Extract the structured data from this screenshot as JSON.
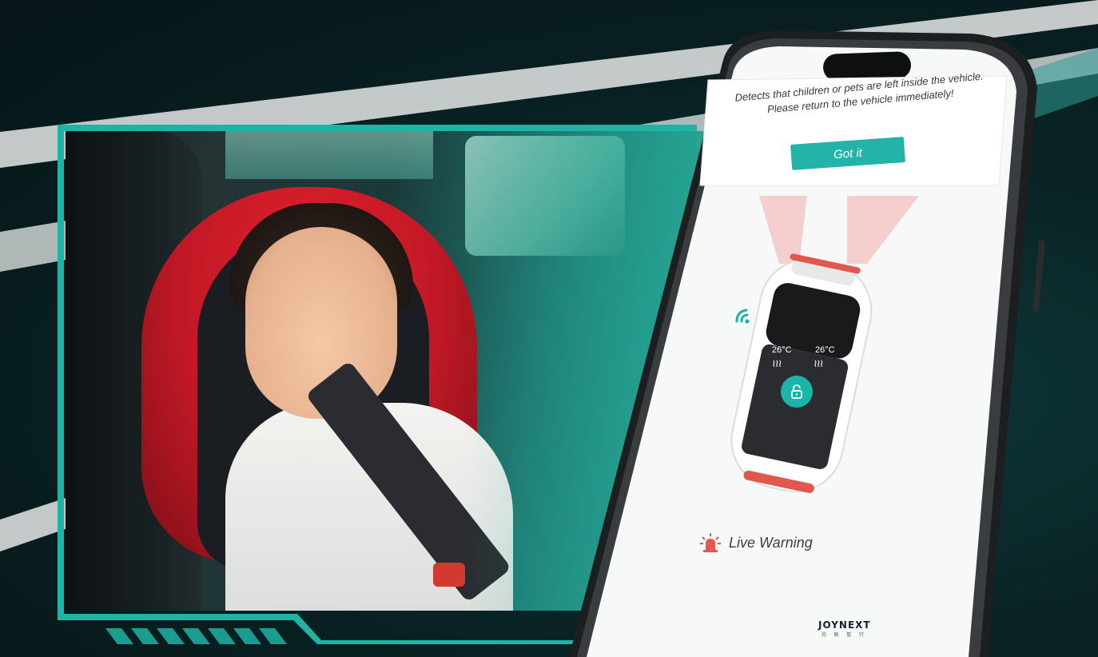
{
  "alert": {
    "line1": "Detects that children or pets are left inside the vehicle.",
    "line2": "Please return to the vehicle immediately!",
    "button_label": "Got it"
  },
  "vehicle": {
    "left_temp": "26°C",
    "right_temp": "26°C",
    "heat_symbol": "≀≀≀",
    "lock_state": "unlocked"
  },
  "status": {
    "live_warning_label": "Live Warning"
  },
  "brand": {
    "name": "JOYNEXT",
    "sub": "均 联 智 行"
  },
  "colors": {
    "accent": "#24b3aa",
    "warning": "#e9564d",
    "background": "#0a2526"
  }
}
